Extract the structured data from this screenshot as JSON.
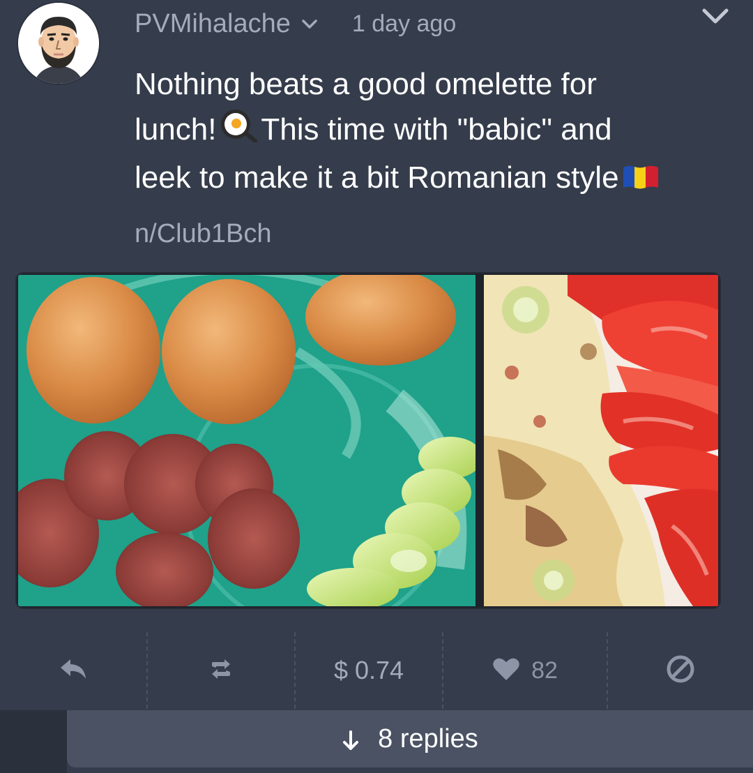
{
  "post": {
    "username": "PVMihalache",
    "timestamp": "1 day ago",
    "body_lines": [
      "Nothing beats a good omelette for",
      "lunch!",
      "This time with \"babic\" and",
      "leek to make it a bit Romanian style"
    ],
    "community": "n/Club1Bch"
  },
  "actions": {
    "payout": "$ 0.74",
    "likes": "82"
  },
  "replies": {
    "label": "8 replies"
  },
  "colors": {
    "background": "#353c4b",
    "muted_text": "#a4acbc",
    "icon": "#8d95a6",
    "replies_bar": "#4a5263"
  },
  "icons": [
    "user-avatar",
    "chevron-down-icon",
    "fried-egg-emoji",
    "romania-flag-emoji",
    "reply-icon",
    "repost-icon",
    "heart-icon",
    "block-icon",
    "arrow-down-icon"
  ]
}
